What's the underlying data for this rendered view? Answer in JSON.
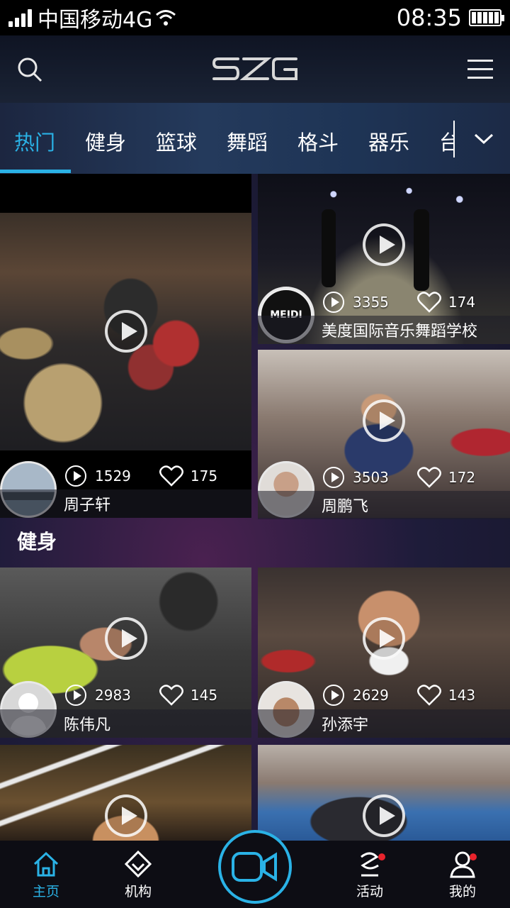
{
  "status_bar": {
    "carrier": "中国移动4G",
    "time": "08:35"
  },
  "header": {
    "logo": "SZG"
  },
  "tabs": [
    "热门",
    "健身",
    "篮球",
    "舞蹈",
    "格斗",
    "器乐",
    "台"
  ],
  "hot_cards": [
    {
      "name": "周子轩",
      "plays": "1529",
      "likes": "175"
    },
    {
      "name": "美度国际音乐舞蹈学校",
      "plays": "3355",
      "likes": "174",
      "avatar_text": "MEIDI"
    },
    {
      "name": "周鹏飞",
      "plays": "3503",
      "likes": "172"
    }
  ],
  "section": {
    "title": "健身"
  },
  "fitness_cards": [
    {
      "name": "陈伟凡",
      "plays": "2983",
      "likes": "145"
    },
    {
      "name": "孙添宇",
      "plays": "2629",
      "likes": "143"
    }
  ],
  "nav": [
    {
      "label": "主页",
      "icon": "home-icon"
    },
    {
      "label": "机构",
      "icon": "institution-icon"
    },
    {
      "label": "活动",
      "icon": "activity-icon"
    },
    {
      "label": "我的",
      "icon": "profile-icon"
    }
  ],
  "colors": {
    "accent": "#2ab2e6",
    "badge": "#e8232c"
  }
}
